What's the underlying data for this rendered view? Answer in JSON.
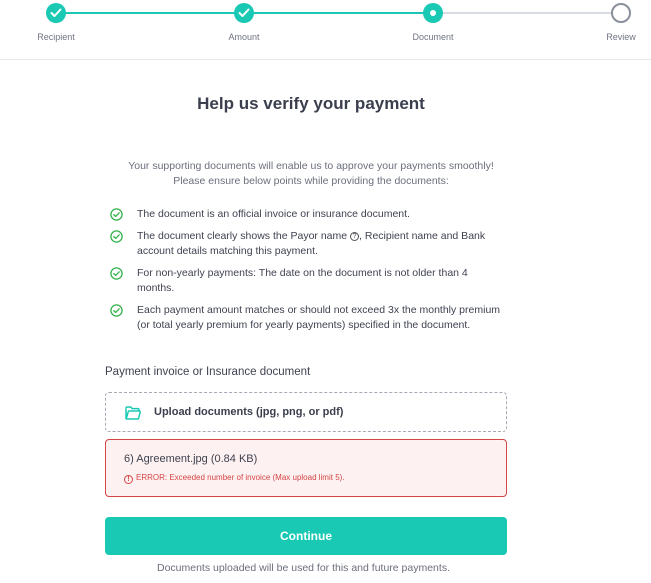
{
  "stepper": {
    "steps": [
      {
        "label": "Recipient",
        "status": "complete"
      },
      {
        "label": "Amount",
        "status": "complete"
      },
      {
        "label": "Document",
        "status": "current"
      },
      {
        "label": "Review",
        "status": "pending"
      }
    ]
  },
  "main": {
    "title": "Help us verify your payment",
    "intro_line1": "Your supporting documents will enable us to approve your payments smoothly!",
    "intro_line2": "Please ensure below points while providing the documents:",
    "checklist": [
      "The document is an official invoice or insurance document.",
      "The document clearly shows the Payor name",
      "Recipient name and Bank account details matching this payment.",
      "For non-yearly payments: The date on the document is not older than 4 months.",
      "Each payment amount matches or should not exceed 3x the monthly premium (or total yearly premium for yearly payments) specified in the document."
    ],
    "section_label": "Payment invoice or Insurance document",
    "upload_label": "Upload documents (jpg, png, or pdf)",
    "error_item": {
      "file": "6) Agreement.jpg (0.84 KB)",
      "message": "ERROR: Exceeded number of invoice (Max upload limit 5)."
    },
    "continue_label": "Continue",
    "footnote": "Documents uploaded will be used for this and future payments."
  },
  "colors": {
    "accent": "#19c9b4",
    "error": "#d64545",
    "error_bg": "#fdf1f1"
  },
  "icons": [
    "check-icon",
    "check-circle-icon",
    "question-icon",
    "folder-icon",
    "error-icon"
  ]
}
